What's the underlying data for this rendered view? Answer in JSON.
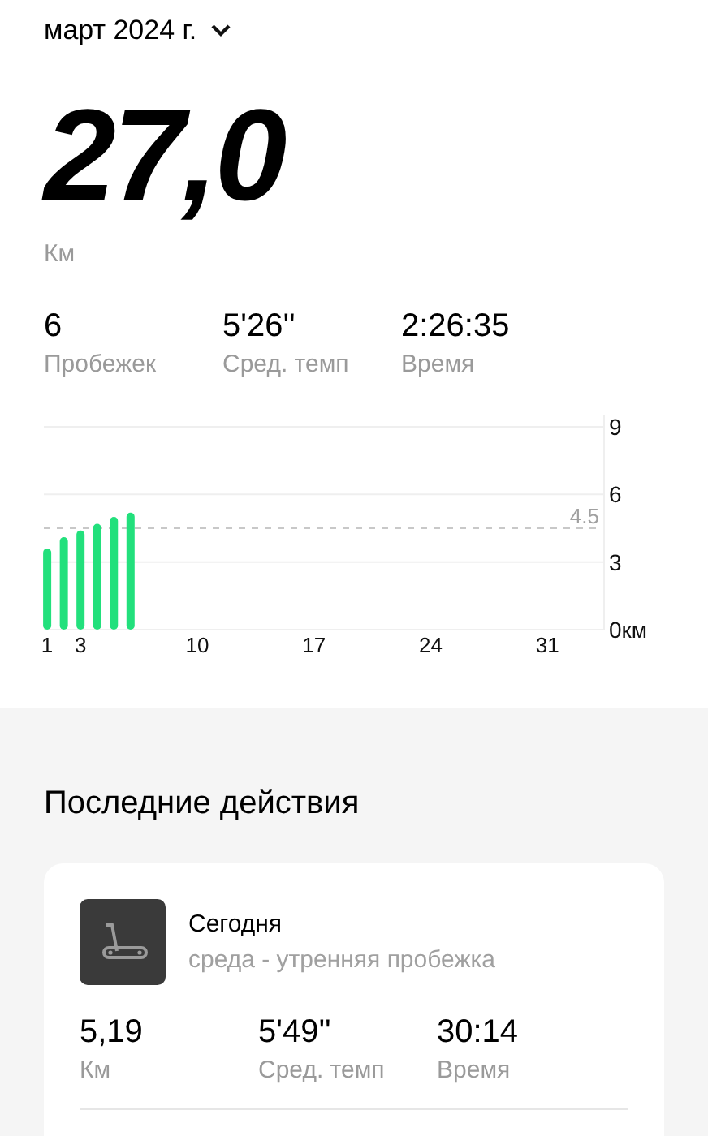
{
  "period": {
    "label": "март 2024 г."
  },
  "total": {
    "value": "27,0",
    "unit": "Км"
  },
  "stats": [
    {
      "value": "6",
      "label": "Пробежек"
    },
    {
      "value": "5'26''",
      "label": "Сред. темп"
    },
    {
      "value": "2:26:35",
      "label": "Время"
    }
  ],
  "chart_data": {
    "type": "bar",
    "x": [
      1,
      2,
      3,
      4,
      5,
      6
    ],
    "series": [
      {
        "color": "#22e07c",
        "values": [
          3.6,
          4.1,
          4.4,
          4.7,
          5.0,
          5.19
        ]
      }
    ],
    "xlim": [
      0.8,
      34.4
    ],
    "ylim": [
      0,
      9
    ],
    "xticks": [
      1,
      3,
      10,
      17,
      24,
      31
    ],
    "yticks": [
      {
        "value": 0,
        "label": "0км"
      },
      3,
      6,
      9
    ],
    "ref_lines": [
      {
        "axis": "y",
        "value": 4.5,
        "label": "4.5"
      }
    ]
  },
  "recent": {
    "title": "Последние действия",
    "activities": [
      {
        "title": "Сегодня",
        "subtitle": "среда - утренняя пробежка",
        "stats": [
          {
            "value": "5,19",
            "label": "Км"
          },
          {
            "value": "5'49''",
            "label": "Сред. темп"
          },
          {
            "value": "30:14",
            "label": "Время"
          }
        ]
      }
    ]
  }
}
